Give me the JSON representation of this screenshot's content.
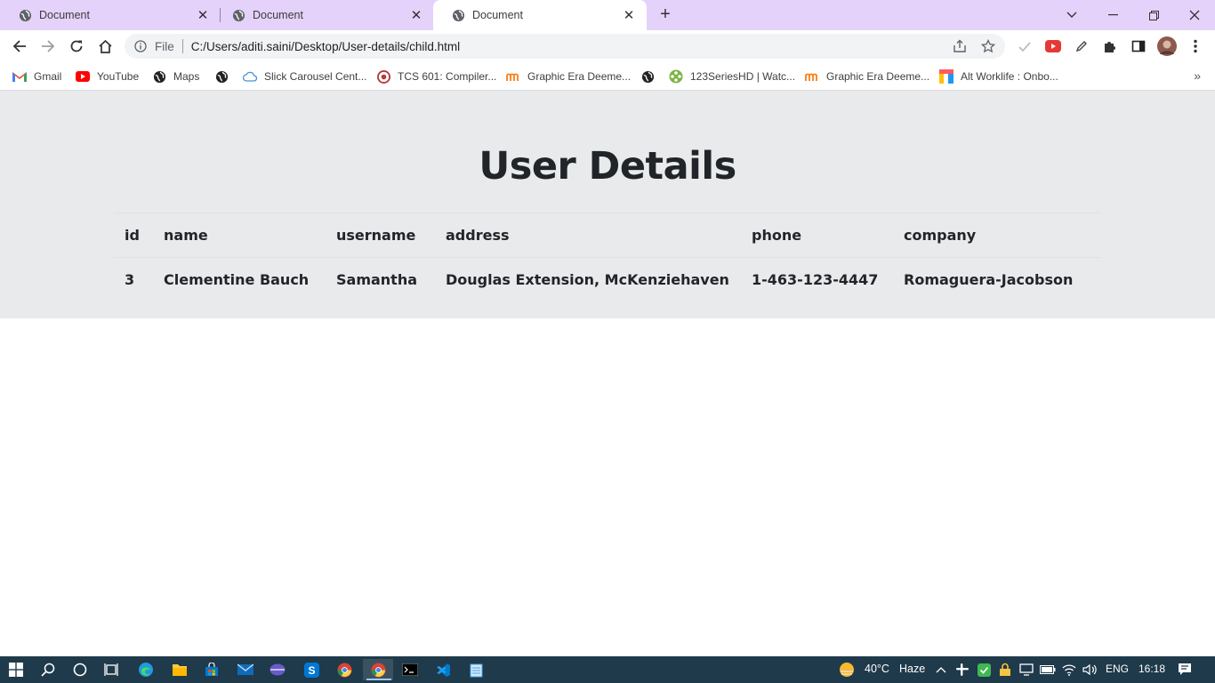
{
  "browser": {
    "tabs": [
      {
        "title": "Document",
        "active": false
      },
      {
        "title": "Document",
        "active": false
      },
      {
        "title": "Document",
        "active": true
      }
    ],
    "address": {
      "scheme_label": "File",
      "url": "C:/Users/aditi.saini/Desktop/User-details/child.html"
    },
    "bookmarks": [
      {
        "label": "Gmail",
        "icon": "gmail-icon"
      },
      {
        "label": "YouTube",
        "icon": "youtube-icon"
      },
      {
        "label": "Maps",
        "icon": "globe-icon"
      },
      {
        "label": "",
        "icon": "globe-icon"
      },
      {
        "label": "Slick Carousel Cent...",
        "icon": "cloud-icon"
      },
      {
        "label": "TCS 601: Compiler...",
        "icon": "compiler-icon"
      },
      {
        "label": "Graphic Era Deeme...",
        "icon": "moodle-icon"
      },
      {
        "label": "",
        "icon": "globe-icon"
      },
      {
        "label": "123SeriesHD | Watc...",
        "icon": "film-icon"
      },
      {
        "label": "Graphic Era Deeme...",
        "icon": "moodle-icon"
      },
      {
        "label": "Alt Worklife : Onbo...",
        "icon": "altworklife-icon"
      }
    ]
  },
  "page": {
    "heading": "User Details",
    "table": {
      "columns": [
        "id",
        "name",
        "username",
        "address",
        "phone",
        "company"
      ],
      "rows": [
        [
          "3",
          "Clementine Bauch",
          "Samantha",
          "Douglas Extension, McKenziehaven",
          "1-463-123-4447",
          "Romaguera-Jacobson"
        ]
      ]
    }
  },
  "taskbar": {
    "weather": {
      "temp": "40°C",
      "condition": "Haze"
    },
    "language": "ENG",
    "time": "16:18"
  },
  "colors": {
    "tabstrip": "#e5d2fb",
    "panel": "#e8eaec",
    "taskbar": "#1f3a4a"
  }
}
